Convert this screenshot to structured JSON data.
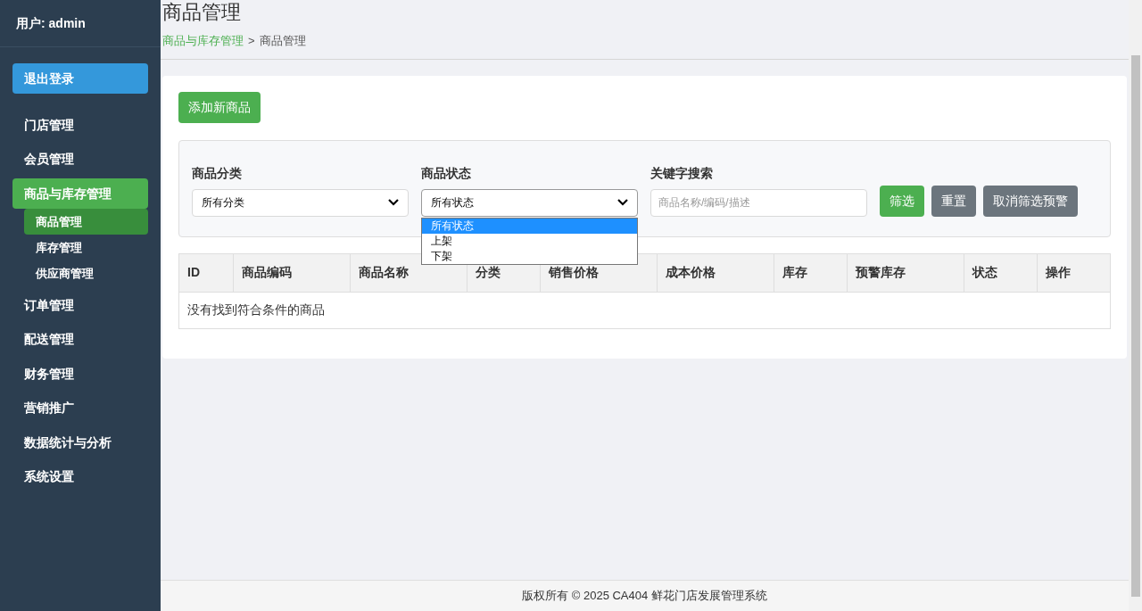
{
  "sidebar": {
    "user": "用户: admin",
    "logout": "退出登录",
    "items": [
      {
        "label": "门店管理",
        "selected": false
      },
      {
        "label": "会员管理",
        "selected": false
      },
      {
        "label": "商品与库存管理",
        "selected": true,
        "children": [
          {
            "label": "商品管理",
            "selected": true
          },
          {
            "label": "库存管理",
            "selected": false
          },
          {
            "label": "供应商管理",
            "selected": false
          }
        ]
      },
      {
        "label": "订单管理",
        "selected": false
      },
      {
        "label": "配送管理",
        "selected": false
      },
      {
        "label": "财务管理",
        "selected": false
      },
      {
        "label": "营销推广",
        "selected": false
      },
      {
        "label": "数据统计与分析",
        "selected": false
      },
      {
        "label": "系统设置",
        "selected": false
      }
    ]
  },
  "header": {
    "title": "商品管理",
    "breadcrumb": [
      {
        "label": "商品与库存管理",
        "kind": "link"
      },
      {
        "label": ">",
        "kind": "separator"
      },
      {
        "label": "商品管理",
        "kind": "current"
      }
    ]
  },
  "add_button": "添加新商品",
  "filters": {
    "category": {
      "label": "商品分类",
      "value": "所有分类"
    },
    "status": {
      "label": "商品状态",
      "value": "所有状态",
      "expanded": true,
      "options": [
        {
          "label": "所有状态",
          "selected": true
        },
        {
          "label": "上架",
          "selected": false
        },
        {
          "label": "下架",
          "selected": false
        }
      ]
    },
    "keyword": {
      "label": "关键字搜索",
      "placeholder": "商品名称/编码/描述"
    },
    "buttons": [
      {
        "label": "筛选",
        "kind": "primary"
      },
      {
        "label": "重置",
        "kind": "secondary"
      },
      {
        "label": "取消筛选预警",
        "kind": "secondary"
      }
    ]
  },
  "table": {
    "columns": [
      "ID",
      "商品编码",
      "商品名称",
      "分类",
      "销售价格",
      "成本价格",
      "库存",
      "预警库存",
      "状态",
      "操作"
    ],
    "empty_message": "没有找到符合条件的商品"
  },
  "footer": "版权所有 © 2025 CA404 鲜花门店发展管理系统"
}
